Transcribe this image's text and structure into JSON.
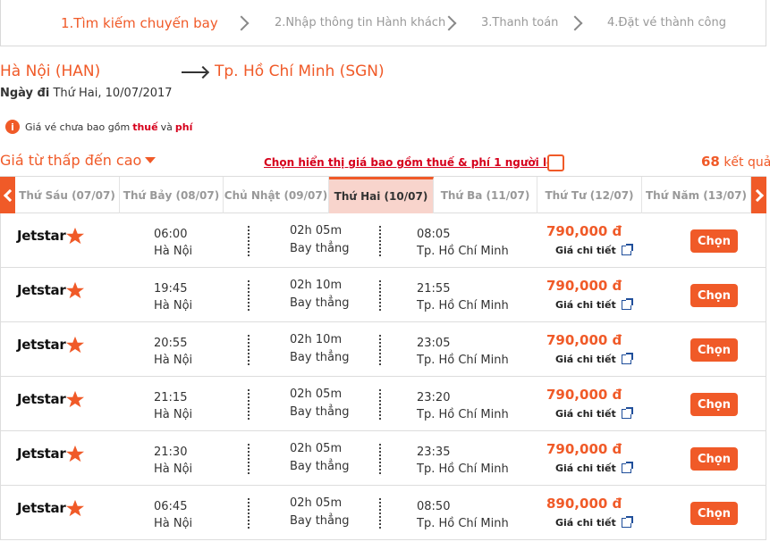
{
  "steps": [
    {
      "label": "1.Tìm kiếm chuyến bay",
      "active": true
    },
    {
      "label": "2.Nhập thông tin Hành khách",
      "active": false
    },
    {
      "label": "3.Thanh toán",
      "active": false
    },
    {
      "label": "4.Đặt vé thành công",
      "active": false
    }
  ],
  "route": {
    "from": "Hà Nội (HAN)",
    "to": "Tp. Hồ Chí Minh (SGN)",
    "date_label": "Ngày đi",
    "date_value": "Thứ Hai, 10/07/2017"
  },
  "notice": {
    "icon": "i",
    "text_before": "Giá vé chưa bao gồm",
    "tax": "thuế",
    "and": "và",
    "fee": "phí"
  },
  "sort": {
    "label": "Giá từ thấp đến cao"
  },
  "include_fees": {
    "label": "Chọn hiển thị giá bao gồm thuế & phí 1 người lớn",
    "checked": false
  },
  "results": {
    "count": "68",
    "label": "kết quả"
  },
  "days": [
    {
      "label": "Thứ Sáu (07/07)",
      "selected": false
    },
    {
      "label": "Thứ Bảy (08/07)",
      "selected": false
    },
    {
      "label": "Chủ Nhật (09/07)",
      "selected": false
    },
    {
      "label": "Thứ Hai (10/07)",
      "selected": true
    },
    {
      "label": "Thứ Ba (11/07)",
      "selected": false
    },
    {
      "label": "Thứ Tư (12/07)",
      "selected": false
    },
    {
      "label": "Thứ Năm (13/07)",
      "selected": false
    }
  ],
  "colors": {
    "accent": "#f05a28",
    "selected_day_bg": "#f8d4cc",
    "red_text": "#d6001c"
  },
  "flights": [
    {
      "airline": "Jetstar",
      "dep_time": "06:00",
      "dep_city": "Hà Nội",
      "duration": "02h 05m",
      "stops": "Bay thẳng",
      "arr_time": "08:05",
      "arr_city": "Tp. Hồ Chí Minh",
      "price": "790,000 đ",
      "detail": "Giá chi tiết",
      "button": "Chọn"
    },
    {
      "airline": "Jetstar",
      "dep_time": "19:45",
      "dep_city": "Hà Nội",
      "duration": "02h 10m",
      "stops": "Bay thẳng",
      "arr_time": "21:55",
      "arr_city": "Tp. Hồ Chí Minh",
      "price": "790,000 đ",
      "detail": "Giá chi tiết",
      "button": "Chọn"
    },
    {
      "airline": "Jetstar",
      "dep_time": "20:55",
      "dep_city": "Hà Nội",
      "duration": "02h 10m",
      "stops": "Bay thẳng",
      "arr_time": "23:05",
      "arr_city": "Tp. Hồ Chí Minh",
      "price": "790,000 đ",
      "detail": "Giá chi tiết",
      "button": "Chọn"
    },
    {
      "airline": "Jetstar",
      "dep_time": "21:15",
      "dep_city": "Hà Nội",
      "duration": "02h 05m",
      "stops": "Bay thẳng",
      "arr_time": "23:20",
      "arr_city": "Tp. Hồ Chí Minh",
      "price": "790,000 đ",
      "detail": "Giá chi tiết",
      "button": "Chọn"
    },
    {
      "airline": "Jetstar",
      "dep_time": "21:30",
      "dep_city": "Hà Nội",
      "duration": "02h 05m",
      "stops": "Bay thẳng",
      "arr_time": "23:35",
      "arr_city": "Tp. Hồ Chí Minh",
      "price": "790,000 đ",
      "detail": "Giá chi tiết",
      "button": "Chọn"
    },
    {
      "airline": "Jetstar",
      "dep_time": "06:45",
      "dep_city": "Hà Nội",
      "duration": "02h 05m",
      "stops": "Bay thẳng",
      "arr_time": "08:50",
      "arr_city": "Tp. Hồ Chí Minh",
      "price": "890,000 đ",
      "detail": "Giá chi tiết",
      "button": "Chọn"
    }
  ]
}
